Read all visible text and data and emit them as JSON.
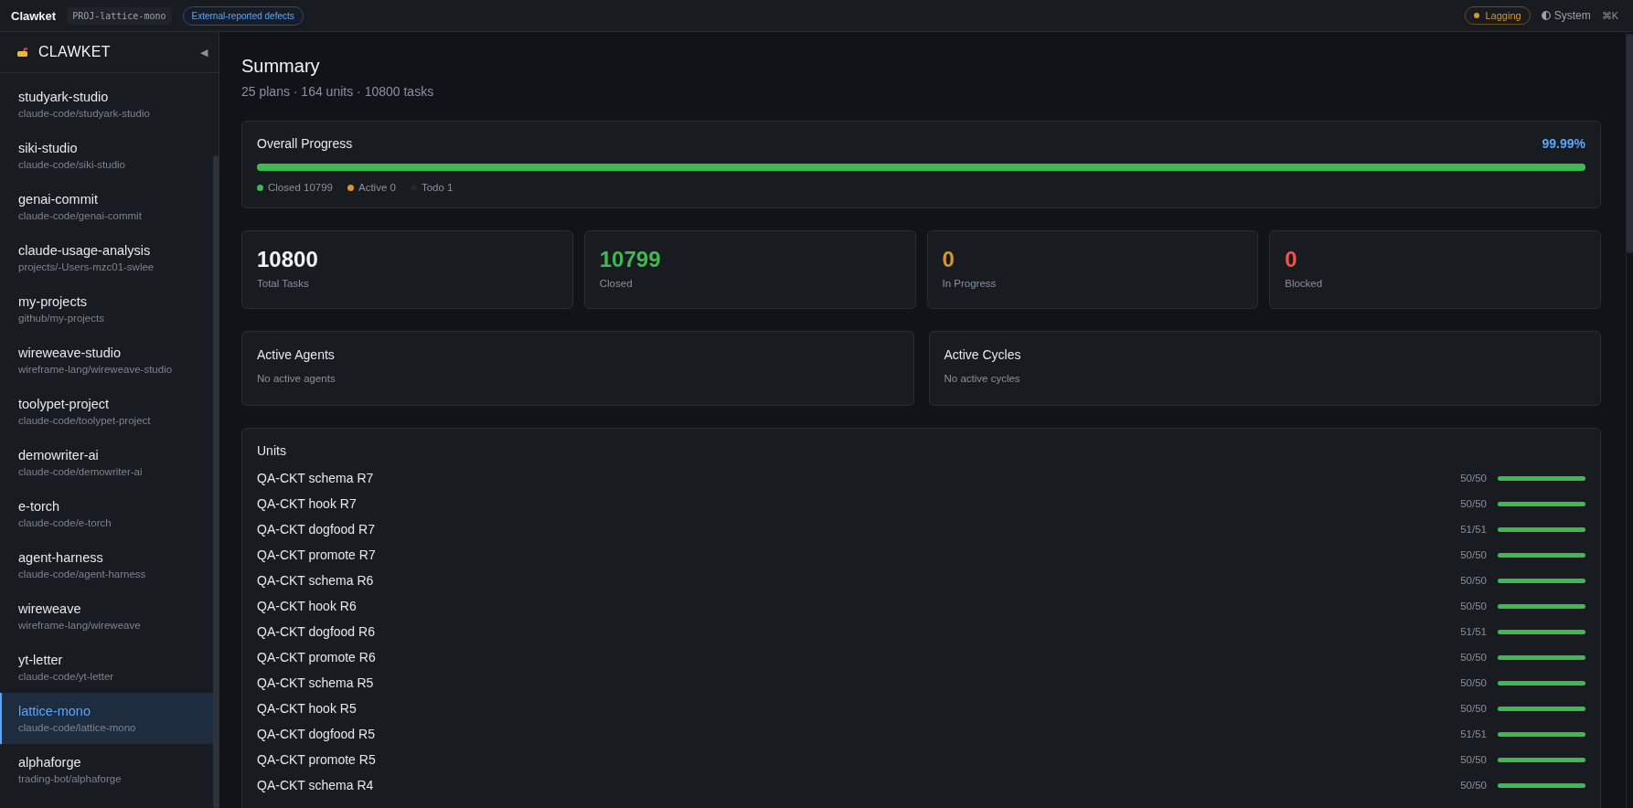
{
  "topbar": {
    "brand": "Clawket",
    "project_id": "PROJ-lattice-mono",
    "filter_badge": "External-reported defects",
    "status": {
      "label": "Lagging",
      "color": "#d6962e"
    },
    "theme": "System",
    "shortcut": "⌘K"
  },
  "sidebar": {
    "title": "CLAWKET",
    "collapse": "◀",
    "items": [
      {
        "name": "studyark-studio",
        "path": "claude-code/studyark-studio",
        "selected": false
      },
      {
        "name": "siki-studio",
        "path": "claude-code/siki-studio",
        "selected": false
      },
      {
        "name": "genai-commit",
        "path": "claude-code/genai-commit",
        "selected": false
      },
      {
        "name": "claude-usage-analysis",
        "path": "projects/-Users-mzc01-swlee",
        "selected": false
      },
      {
        "name": "my-projects",
        "path": "github/my-projects",
        "selected": false
      },
      {
        "name": "wireweave-studio",
        "path": "wireframe-lang/wireweave-studio",
        "selected": false
      },
      {
        "name": "toolypet-project",
        "path": "claude-code/toolypet-project",
        "selected": false
      },
      {
        "name": "demowriter-ai",
        "path": "claude-code/demowriter-ai",
        "selected": false
      },
      {
        "name": "e-torch",
        "path": "claude-code/e-torch",
        "selected": false
      },
      {
        "name": "agent-harness",
        "path": "claude-code/agent-harness",
        "selected": false
      },
      {
        "name": "wireweave",
        "path": "wireframe-lang/wireweave",
        "selected": false
      },
      {
        "name": "yt-letter",
        "path": "claude-code/yt-letter",
        "selected": false
      },
      {
        "name": "lattice-mono",
        "path": "claude-code/lattice-mono",
        "selected": true
      },
      {
        "name": "alphaforge",
        "path": "trading-bot/alphaforge",
        "selected": false
      }
    ]
  },
  "summary": {
    "title": "Summary",
    "subtitle": "25 plans · 164 units · 10800 tasks"
  },
  "overall": {
    "title": "Overall Progress",
    "percent": "99.99%",
    "level": 0.9999,
    "legend": [
      {
        "label": "Closed 10799",
        "color": "#3fb950"
      },
      {
        "label": "Active 0",
        "color": "#d6962e"
      },
      {
        "label": "Todo 1",
        "color": "#22262e"
      }
    ]
  },
  "stats": [
    {
      "value": "10800",
      "label": "Total Tasks",
      "color": "#f0f3f6"
    },
    {
      "value": "10799",
      "label": "Closed",
      "color": "#3fb950"
    },
    {
      "value": "0",
      "label": "In Progress",
      "color": "#d6962e"
    },
    {
      "value": "0",
      "label": "Blocked",
      "color": "#f85149"
    }
  ],
  "panels": [
    {
      "title": "Active Agents",
      "empty": "No active agents"
    },
    {
      "title": "Active Cycles",
      "empty": "No active cycles"
    }
  ],
  "units": {
    "title": "Units",
    "rows": [
      {
        "name": "QA-CKT schema R7",
        "count": "50/50",
        "level": 1
      },
      {
        "name": "QA-CKT hook R7",
        "count": "50/50",
        "level": 1
      },
      {
        "name": "QA-CKT dogfood R7",
        "count": "51/51",
        "level": 1
      },
      {
        "name": "QA-CKT promote R7",
        "count": "50/50",
        "level": 1
      },
      {
        "name": "QA-CKT schema R6",
        "count": "50/50",
        "level": 1
      },
      {
        "name": "QA-CKT hook R6",
        "count": "50/50",
        "level": 1
      },
      {
        "name": "QA-CKT dogfood R6",
        "count": "51/51",
        "level": 1
      },
      {
        "name": "QA-CKT promote R6",
        "count": "50/50",
        "level": 1
      },
      {
        "name": "QA-CKT schema R5",
        "count": "50/50",
        "level": 1
      },
      {
        "name": "QA-CKT hook R5",
        "count": "50/50",
        "level": 1
      },
      {
        "name": "QA-CKT dogfood R5",
        "count": "51/51",
        "level": 1
      },
      {
        "name": "QA-CKT promote R5",
        "count": "50/50",
        "level": 1
      },
      {
        "name": "QA-CKT schema R4",
        "count": "50/50",
        "level": 1
      }
    ]
  }
}
